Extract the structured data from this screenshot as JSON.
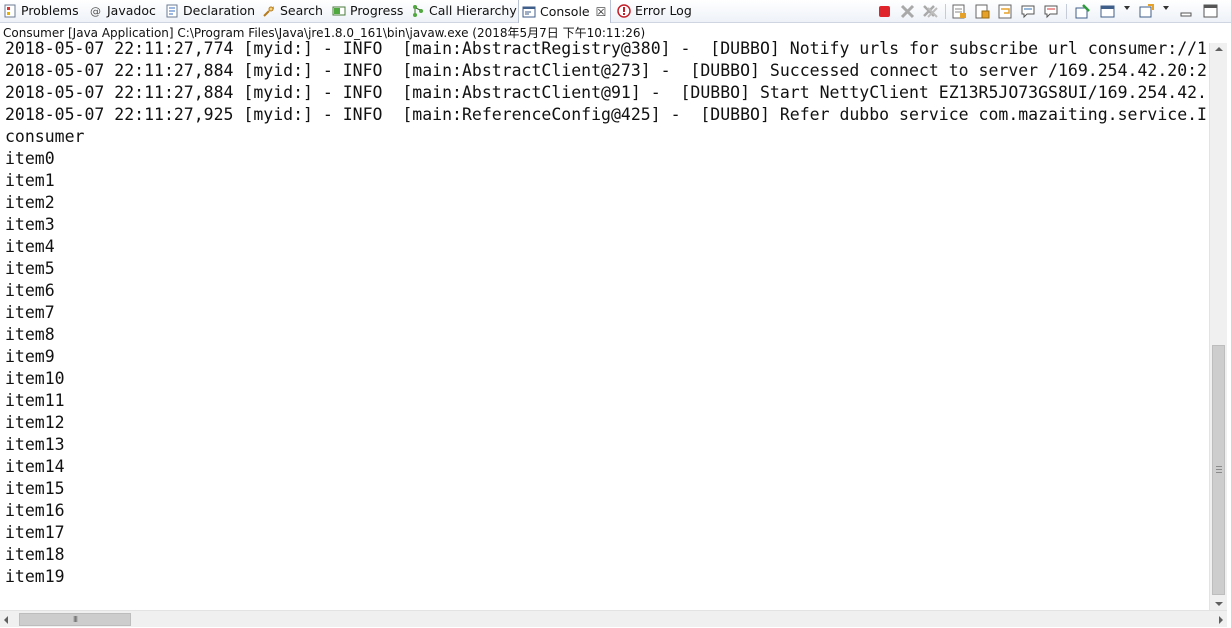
{
  "tabs": [
    {
      "label": "Problems",
      "icon": "problems-icon",
      "active": false
    },
    {
      "label": "Javadoc",
      "icon": "javadoc-icon",
      "active": false
    },
    {
      "label": "Declaration",
      "icon": "declaration-icon",
      "active": false
    },
    {
      "label": "Search",
      "icon": "search-icon",
      "active": false
    },
    {
      "label": "Progress",
      "icon": "progress-icon",
      "active": false
    },
    {
      "label": "Call Hierarchy",
      "icon": "call-hierarchy-icon",
      "active": false
    },
    {
      "label": "Console",
      "icon": "console-icon",
      "active": true,
      "close": "☒"
    },
    {
      "label": "Error Log",
      "icon": "error-log-icon",
      "active": false
    }
  ],
  "toolbar": {
    "icons": [
      "terminate-icon",
      "remove-launch-icon",
      "remove-all-terminated-icon",
      "clear-console-icon",
      "scroll-lock-icon",
      "word-wrap-icon",
      "show-on-stdout-icon",
      "show-on-stderr-icon",
      "pin-console-icon",
      "display-selected-console-icon",
      "open-console-icon",
      "minimize-icon",
      "maximize-icon"
    ],
    "colors": {
      "terminate": "#e0242c",
      "accent": "#2e6db6"
    }
  },
  "description": "Consumer [Java Application] C:\\Program Files\\Java\\jre1.8.0_161\\bin\\javaw.exe (2018年5月7日 下午10:11:26)",
  "console": {
    "lines": [
      "2018-05-07 22:11:27,774 [myid:] - INFO  [main:AbstractRegistry@380] -  [DUBBO] Notify urls for subscribe url consumer://1",
      "2018-05-07 22:11:27,884 [myid:] - INFO  [main:AbstractClient@273] -  [DUBBO] Successed connect to server /169.254.42.20:2",
      "2018-05-07 22:11:27,884 [myid:] - INFO  [main:AbstractClient@91] -  [DUBBO] Start NettyClient EZ13R5JO73GS8UI/169.254.42.",
      "2018-05-07 22:11:27,925 [myid:] - INFO  [main:ReferenceConfig@425] -  [DUBBO] Refer dubbo service com.mazaiting.service.I",
      "consumer",
      "item0",
      "item1",
      "item2",
      "item3",
      "item4",
      "item5",
      "item6",
      "item7",
      "item8",
      "item9",
      "item10",
      "item11",
      "item12",
      "item13",
      "item14",
      "item15",
      "item16",
      "item17",
      "item18",
      "item19"
    ]
  },
  "hscroll": {
    "thumb_label": "III"
  }
}
